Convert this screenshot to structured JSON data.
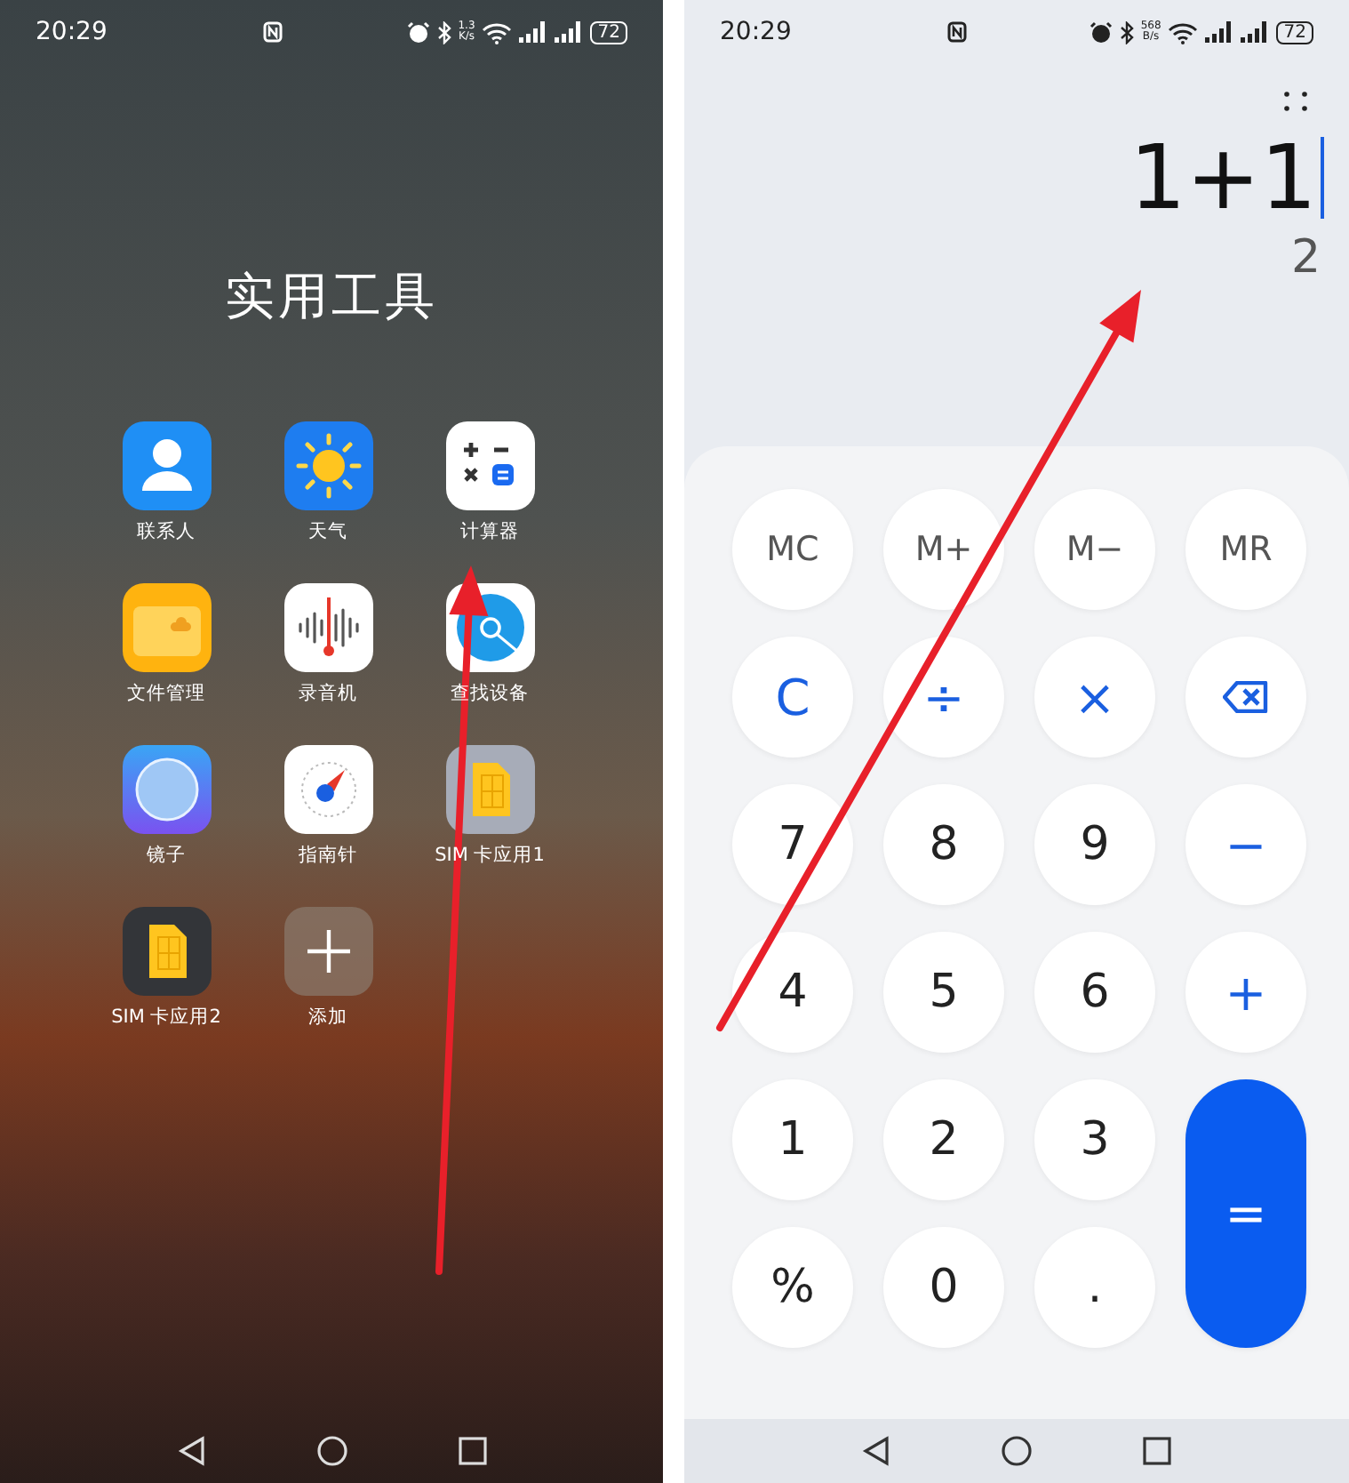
{
  "home_screen": {
    "status_bar": {
      "time": "20:29",
      "speed_value": "1.3",
      "speed_unit": "K/s",
      "battery": "72"
    },
    "folder_title": "实用工具",
    "apps": [
      {
        "label": "联系人",
        "kind": "contacts"
      },
      {
        "label": "天气",
        "kind": "weather"
      },
      {
        "label": "计算器",
        "kind": "calculator"
      },
      {
        "label": "文件管理",
        "kind": "files"
      },
      {
        "label": "录音机",
        "kind": "recorder"
      },
      {
        "label": "查找设备",
        "kind": "finder"
      },
      {
        "label": "镜子",
        "kind": "mirror"
      },
      {
        "label": "指南针",
        "kind": "compass"
      },
      {
        "label": "SIM 卡应用1",
        "kind": "sim"
      },
      {
        "label": "SIM 卡应用2",
        "kind": "sim-dark"
      },
      {
        "label": "添加",
        "kind": "add"
      }
    ]
  },
  "calculator": {
    "status_bar": {
      "time": "20:29",
      "speed_value": "568",
      "speed_unit": "B/s",
      "battery": "72"
    },
    "expression": "1+1",
    "result": "2",
    "keys": [
      {
        "label": "MC",
        "kind": "memory"
      },
      {
        "label": "M+",
        "kind": "memory"
      },
      {
        "label": "M−",
        "kind": "memory"
      },
      {
        "label": "MR",
        "kind": "memory"
      },
      {
        "label": "C",
        "kind": "operator"
      },
      {
        "label": "÷",
        "kind": "operator"
      },
      {
        "label": "×",
        "kind": "operator"
      },
      {
        "kind": "backspace"
      },
      {
        "label": "7",
        "kind": "digit"
      },
      {
        "label": "8",
        "kind": "digit"
      },
      {
        "label": "9",
        "kind": "digit"
      },
      {
        "label": "−",
        "kind": "operator"
      },
      {
        "label": "4",
        "kind": "digit"
      },
      {
        "label": "5",
        "kind": "digit"
      },
      {
        "label": "6",
        "kind": "digit"
      },
      {
        "label": "+",
        "kind": "operator"
      },
      {
        "label": "1",
        "kind": "digit"
      },
      {
        "label": "2",
        "kind": "digit"
      },
      {
        "label": "3",
        "kind": "digit"
      },
      {
        "label": "=",
        "kind": "equals"
      },
      {
        "label": "%",
        "kind": "digit"
      },
      {
        "label": "0",
        "kind": "digit"
      },
      {
        "label": ".",
        "kind": "digit"
      }
    ]
  }
}
